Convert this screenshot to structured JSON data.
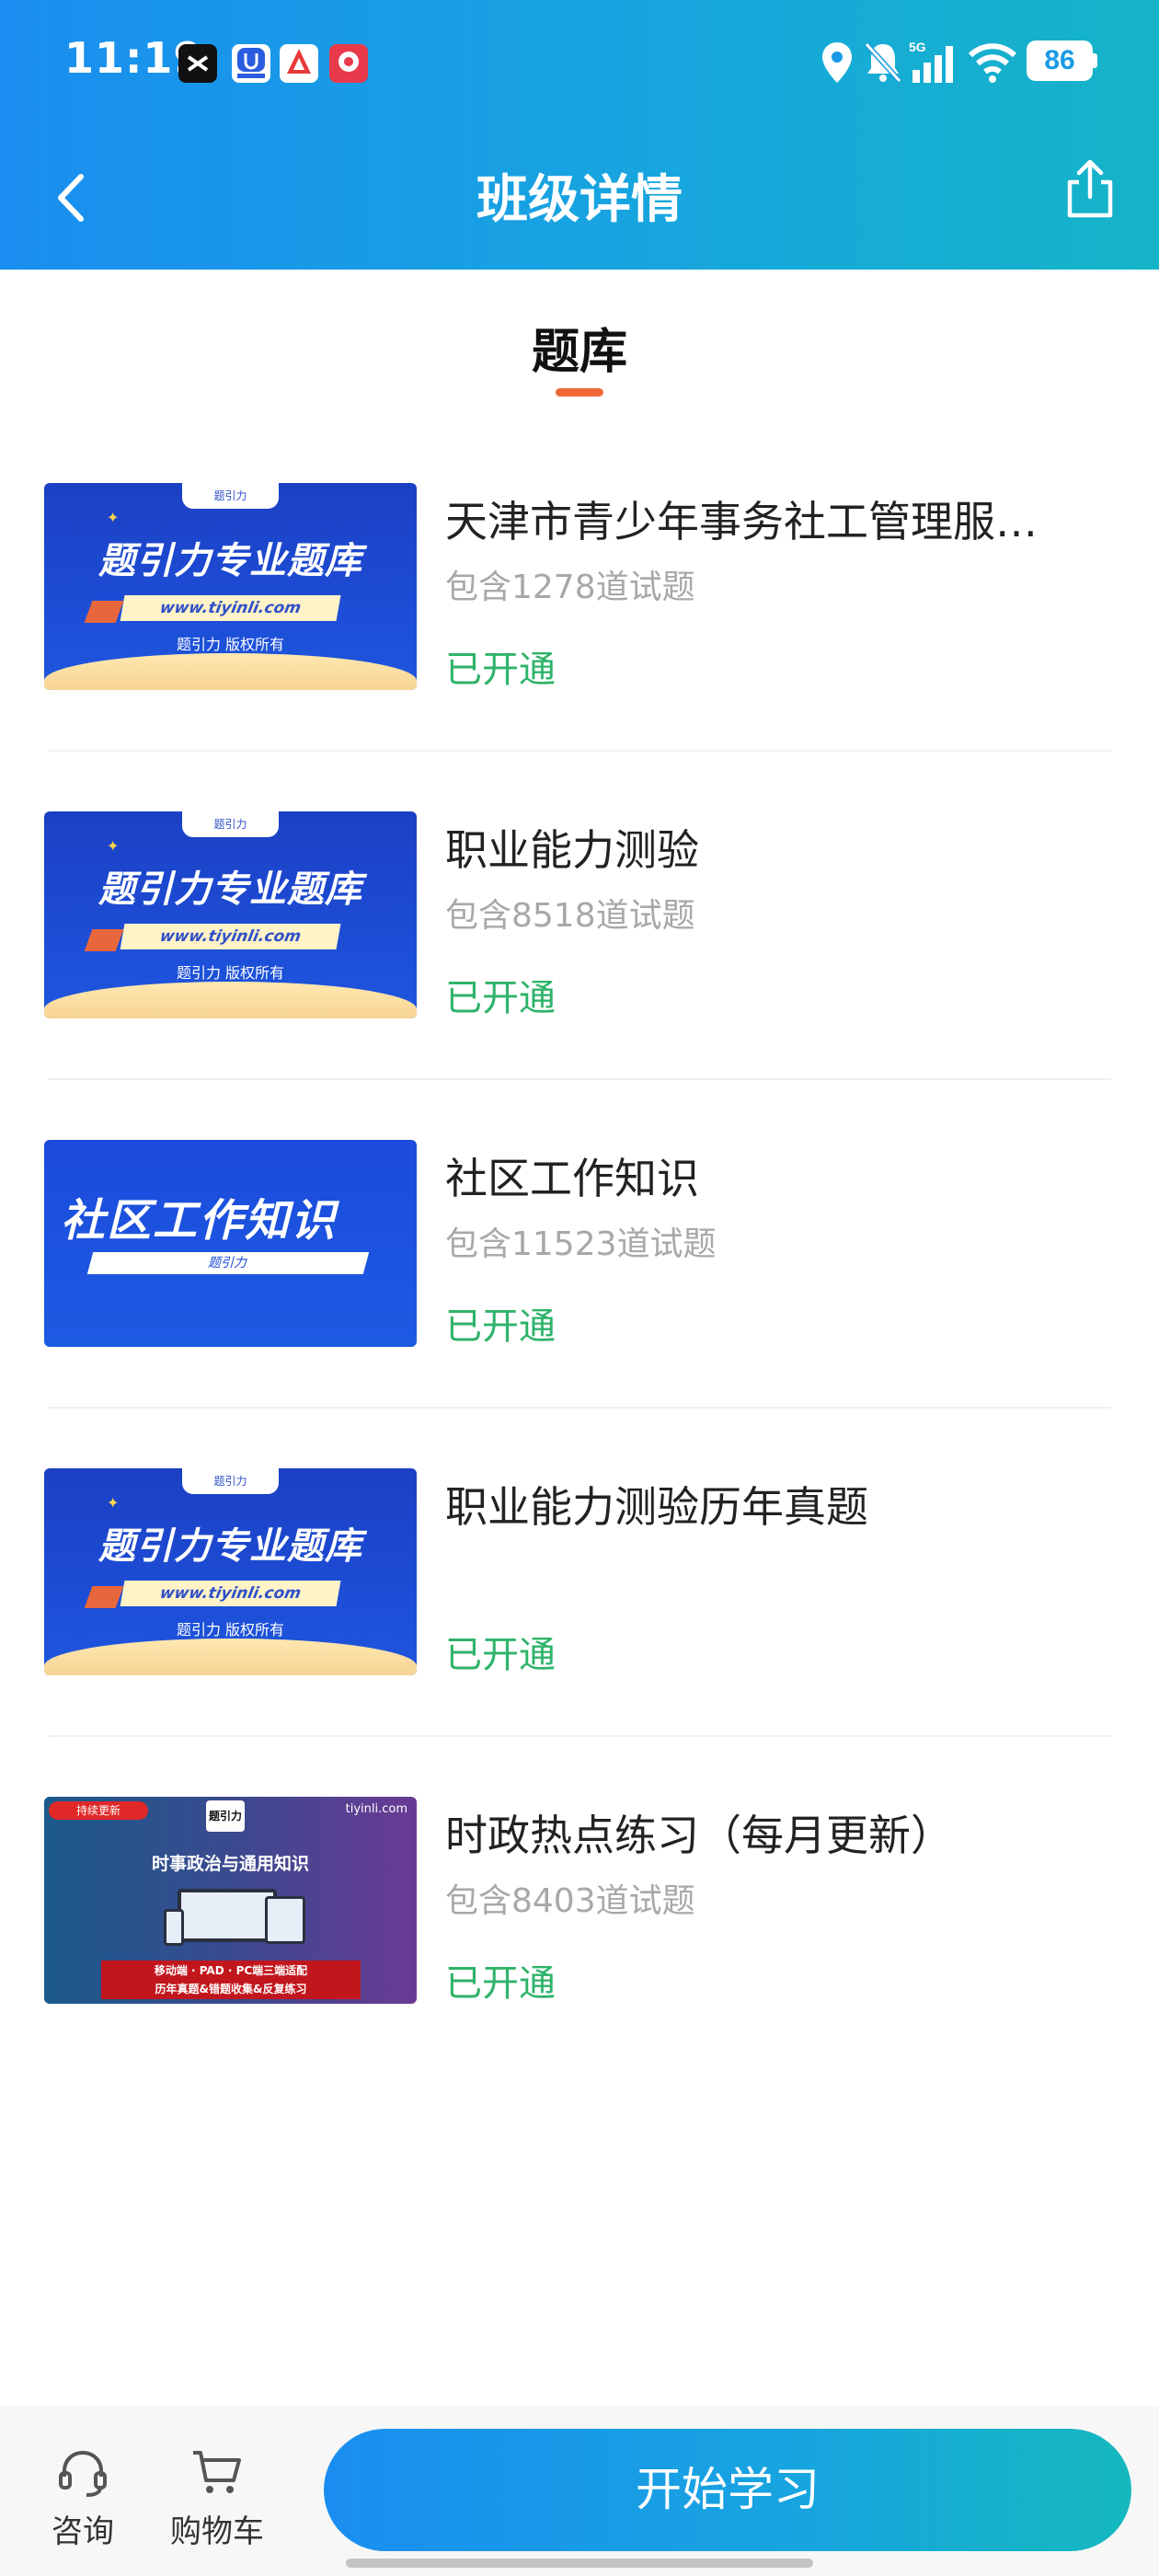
{
  "status_bar": {
    "time": "11:19",
    "battery": "86",
    "network": "5G"
  },
  "header": {
    "title": "班级详情"
  },
  "section_tab": {
    "label": "题库"
  },
  "items": [
    {
      "title": "天津市青少年事务社工管理服…",
      "count": "包含1278道试题",
      "status": "已开通",
      "thumb": {
        "tag": "题引力",
        "headline": "题引力专业题库",
        "url": "www.tiyinli.com",
        "copyright": "题引力 版权所有"
      }
    },
    {
      "title": "职业能力测验",
      "count": "包含8518道试题",
      "status": "已开通",
      "thumb": {
        "tag": "题引力",
        "headline": "题引力专业题库",
        "url": "www.tiyinli.com",
        "copyright": "题引力 版权所有"
      }
    },
    {
      "title": "社区工作知识",
      "count": "包含11523道试题",
      "status": "已开通",
      "thumb": {
        "headline": "社区工作知识",
        "sub": "题引力"
      }
    },
    {
      "title": "职业能力测验历年真题",
      "count": "",
      "status": "已开通",
      "thumb": {
        "tag": "题引力",
        "headline": "题引力专业题库",
        "url": "www.tiyinli.com",
        "copyright": "题引力 版权所有"
      }
    },
    {
      "title": "时政热点练习（每月更新）",
      "count": "包含8403道试题",
      "status": "已开通",
      "thumb": {
        "badge": "持续更新",
        "logo": "题引力",
        "site": "tiyinli.com",
        "headline": "时事政治与通用知识",
        "line1": "移动端 · PAD · PC端三端适配",
        "line2": "历年真题&错题收集&反复练习"
      }
    }
  ],
  "bottom_bar": {
    "consult_label": "咨询",
    "cart_label": "购物车",
    "start_label": "开始学习"
  },
  "colors": {
    "header_gradient_start": "#1a8ef0",
    "header_gradient_end": "#15b4c8",
    "status_green": "#2fb36a",
    "tab_underline": "#f0673a"
  }
}
